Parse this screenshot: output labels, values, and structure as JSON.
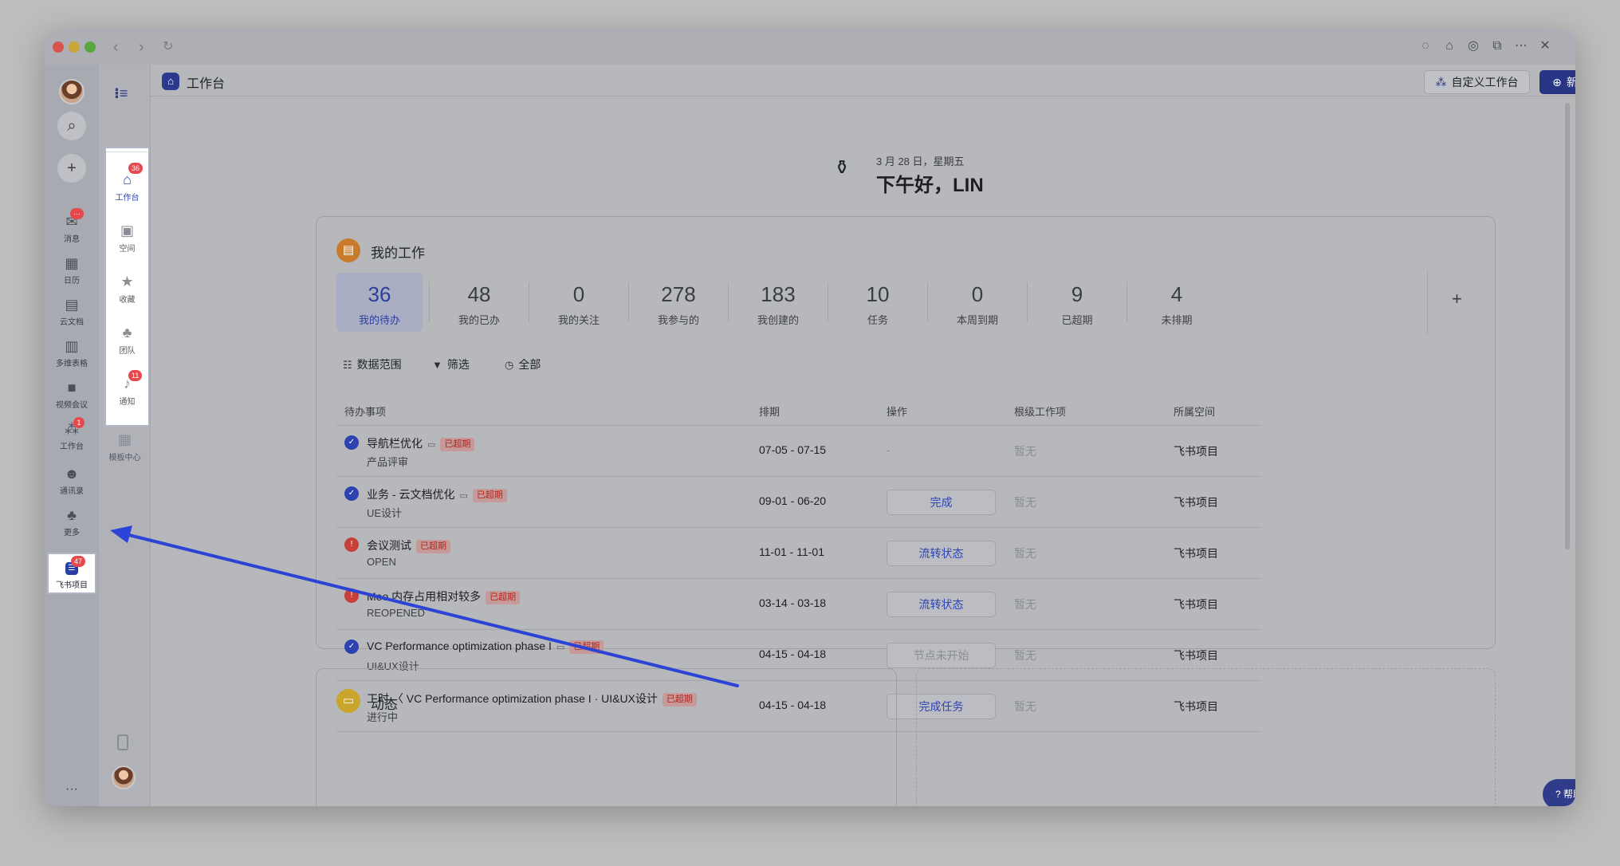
{
  "window": {
    "nav_back": "‹",
    "nav_forward": "›",
    "reload": "↻",
    "toolbar_icons": [
      "chat-bubble-icon",
      "robot-icon",
      "compass-icon",
      "new-window-icon",
      "more-icon",
      "close-icon"
    ]
  },
  "rail_primary": {
    "items": [
      {
        "label": "消息",
        "icon": "chat-icon",
        "badge": "···"
      },
      {
        "label": "日历",
        "icon": "calendar-icon"
      },
      {
        "label": "云文档",
        "icon": "document-icon"
      },
      {
        "label": "多维表格",
        "icon": "table-icon"
      },
      {
        "label": "视频会议",
        "icon": "video-icon"
      },
      {
        "label": "工作台",
        "icon": "grid-icon",
        "badge": "1"
      },
      {
        "label": "通讯录",
        "icon": "contacts-icon"
      },
      {
        "label": "更多",
        "icon": "more-apps-icon"
      }
    ],
    "pinned": {
      "label": "飞书项目",
      "badge": "47"
    },
    "more_dots": "···"
  },
  "rail_secondary": {
    "items": [
      {
        "label": "工作台",
        "badge": "36"
      },
      {
        "label": "空间"
      },
      {
        "label": "收藏"
      },
      {
        "label": "团队"
      },
      {
        "label": "通知",
        "badge": "11"
      },
      {
        "label": "模板中心"
      }
    ]
  },
  "header": {
    "title": "工作台",
    "custom_button": "自定义工作台",
    "new_button": "新建"
  },
  "greeting": {
    "date": "3 月 28 日，星期五",
    "hello": "下午好，LIN"
  },
  "my_work": {
    "title": "我的工作",
    "stats": [
      {
        "num": "36",
        "label": "我的待办"
      },
      {
        "num": "48",
        "label": "我的已办"
      },
      {
        "num": "0",
        "label": "我的关注"
      },
      {
        "num": "278",
        "label": "我参与的"
      },
      {
        "num": "183",
        "label": "我创建的"
      },
      {
        "num": "10",
        "label": "任务"
      },
      {
        "num": "0",
        "label": "本周到期"
      },
      {
        "num": "9",
        "label": "已超期"
      },
      {
        "num": "4",
        "label": "未排期"
      }
    ],
    "plus": "+",
    "filters": [
      "数据范围",
      "筛选",
      "全部"
    ],
    "columns": [
      "待办事项",
      "排期",
      "操作",
      "根级工作项",
      "所属空间"
    ],
    "rows": [
      {
        "title": "导航栏优化",
        "sub": "产品评审",
        "tag": "已超期",
        "date": "07-05 - 07-15",
        "op": "-",
        "root": "暂无",
        "space": "飞书项目"
      },
      {
        "title": "业务 - 云文档优化",
        "sub": "UE设计",
        "tag": "已超期",
        "date": "09-01 - 06-20",
        "op": "完成",
        "root": "暂无",
        "space": "飞书项目"
      },
      {
        "title": "会议测试",
        "sub": "OPEN",
        "tag": "已超期",
        "date": "11-01 - 11-01",
        "op": "流转状态",
        "root": "暂无",
        "space": "飞书项目"
      },
      {
        "title": "Meo 内存占用相对较多",
        "sub": "REOPENED",
        "tag": "已超期",
        "date": "03-14 - 03-18",
        "op": "流转状态",
        "root": "暂无",
        "space": "飞书项目"
      },
      {
        "title": "VC Performance optimization phase I",
        "sub": "UI&UX设计",
        "tag": "已超期",
        "date": "04-15 - 04-18",
        "op": "节点未开始",
        "root": "暂无",
        "space": "飞书项目"
      },
      {
        "title": "工时 〈 VC Performance optimization phase I · UI&UX设计",
        "sub": "进行中",
        "tag": "已超期",
        "date": "04-15 - 04-18",
        "op": "完成任务",
        "root": "暂无",
        "space": "飞书项目"
      }
    ]
  },
  "activity": {
    "title": "动态"
  },
  "help": "帮助",
  "colors": {
    "accent": "#273584",
    "overdue": "#b3261e",
    "arrow": "#2b44d6"
  }
}
